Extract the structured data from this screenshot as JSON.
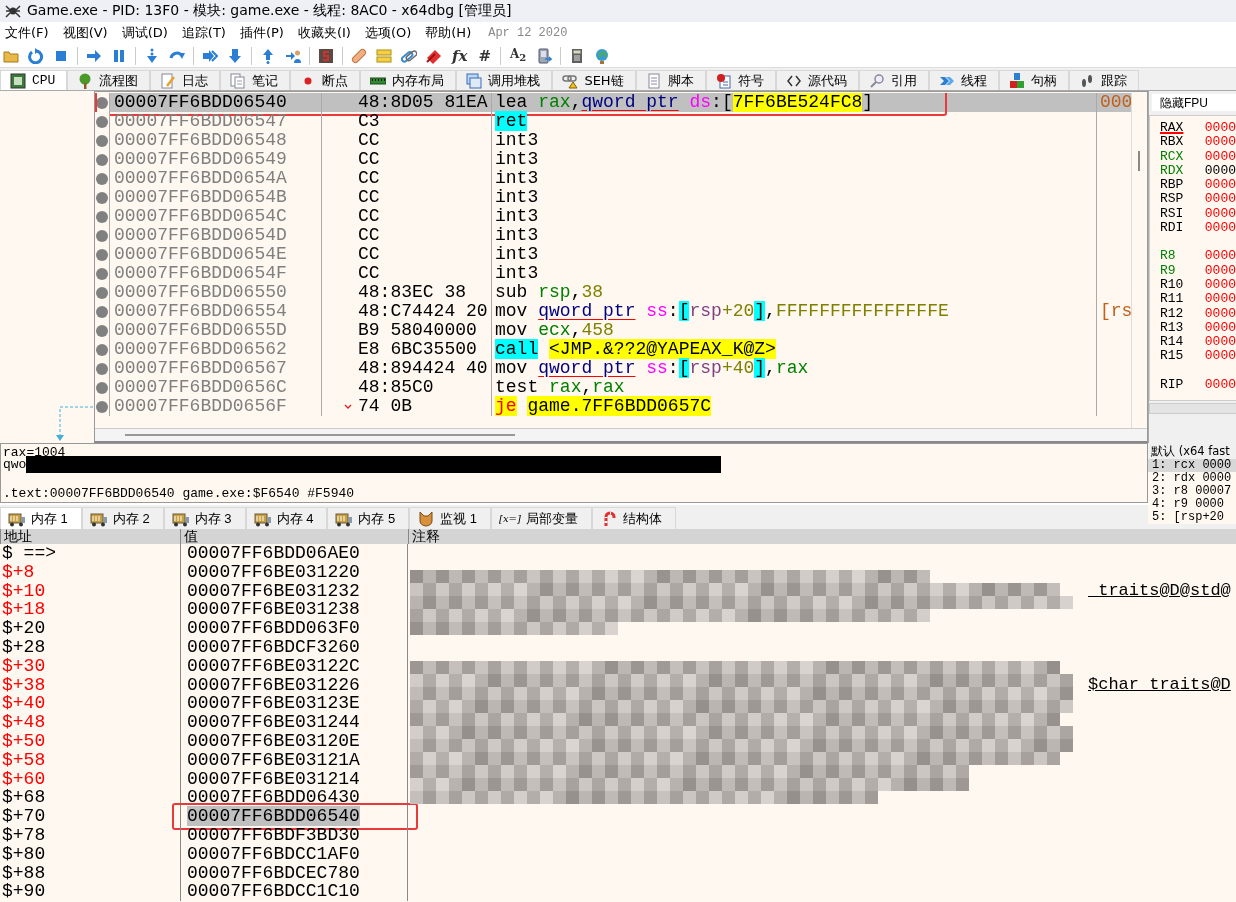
{
  "window": {
    "title": "Game.exe - PID: 13F0 - 模块: game.exe - 线程: 8AC0 - x64dbg [管理员]"
  },
  "menu": [
    "文件(F)",
    "视图(V)",
    "调试(D)",
    "追踪(T)",
    "插件(P)",
    "收藏夹(I)",
    "选项(O)",
    "帮助(H)"
  ],
  "build_date": "Apr 12 2020",
  "toolbar": {
    "glyphs": [
      "fx",
      "#",
      "A$_{2}$"
    ]
  },
  "tabs": [
    {
      "label": "CPU",
      "selected": true
    },
    {
      "label": "流程图",
      "selected": false
    },
    {
      "label": "日志",
      "selected": false
    },
    {
      "label": "笔记",
      "selected": false
    },
    {
      "label": "断点",
      "selected": false
    },
    {
      "label": "内存布局",
      "selected": false
    },
    {
      "label": "调用堆栈",
      "selected": false
    },
    {
      "label": "SEH链",
      "selected": false
    },
    {
      "label": "脚本",
      "selected": false
    },
    {
      "label": "符号",
      "selected": false
    },
    {
      "label": "源代码",
      "selected": false
    },
    {
      "label": "引用",
      "selected": false
    },
    {
      "label": "线程",
      "selected": false
    },
    {
      "label": "句柄",
      "selected": false
    },
    {
      "label": "跟踪",
      "selected": false
    }
  ],
  "disassembly": {
    "rows": [
      {
        "address": "00007FF6BDD06540",
        "bytes": "48:8D05 81EA",
        "tokens": [
          {
            "text": "lea",
            "kind": "m"
          },
          {
            "text": "rax",
            "kind": "r"
          },
          {
            "text": ",",
            "kind": "p"
          },
          {
            "text": "qword ptr",
            "kind": "s"
          },
          {
            "text": "ds",
            "kind": "g"
          },
          {
            "text": ":[",
            "kind": "p"
          },
          {
            "text": "7FF6BE524FC8",
            "kind": "a"
          },
          {
            "text": "]",
            "kind": "p"
          }
        ],
        "comment": "000",
        "selected": true,
        "boxed": true,
        "jump": false
      },
      {
        "address": "00007FF6BDD06547",
        "bytes": "C3",
        "tokens": [
          {
            "text": "ret",
            "kind": "mc"
          }
        ],
        "selected": false,
        "boxed": false,
        "jump": false
      },
      {
        "address": "00007FF6BDD06548",
        "bytes": "CC",
        "tokens": [
          {
            "text": "int3",
            "kind": "m"
          }
        ],
        "selected": false,
        "boxed": false,
        "jump": false
      },
      {
        "address": "00007FF6BDD06549",
        "bytes": "CC",
        "tokens": [
          {
            "text": "int3",
            "kind": "m"
          }
        ],
        "selected": false,
        "boxed": false,
        "jump": false
      },
      {
        "address": "00007FF6BDD0654A",
        "bytes": "CC",
        "tokens": [
          {
            "text": "int3",
            "kind": "m"
          }
        ],
        "selected": false,
        "boxed": false,
        "jump": false
      },
      {
        "address": "00007FF6BDD0654B",
        "bytes": "CC",
        "tokens": [
          {
            "text": "int3",
            "kind": "m"
          }
        ],
        "selected": false,
        "boxed": false,
        "jump": false
      },
      {
        "address": "00007FF6BDD0654C",
        "bytes": "CC",
        "tokens": [
          {
            "text": "int3",
            "kind": "m"
          }
        ],
        "selected": false,
        "boxed": false,
        "jump": false
      },
      {
        "address": "00007FF6BDD0654D",
        "bytes": "CC",
        "tokens": [
          {
            "text": "int3",
            "kind": "m"
          }
        ],
        "selected": false,
        "boxed": false,
        "jump": false
      },
      {
        "address": "00007FF6BDD0654E",
        "bytes": "CC",
        "tokens": [
          {
            "text": "int3",
            "kind": "m"
          }
        ],
        "selected": false,
        "boxed": false,
        "jump": false
      },
      {
        "address": "00007FF6BDD0654F",
        "bytes": "CC",
        "tokens": [
          {
            "text": "int3",
            "kind": "m"
          }
        ],
        "selected": false,
        "boxed": false,
        "jump": false
      },
      {
        "address": "00007FF6BDD06550",
        "bytes": "48:83EC 38",
        "tokens": [
          {
            "text": "sub",
            "kind": "m"
          },
          {
            "text": "rsp",
            "kind": "r"
          },
          {
            "text": ",",
            "kind": "p"
          },
          {
            "text": "38",
            "kind": "n"
          }
        ],
        "selected": false,
        "boxed": false,
        "jump": false
      },
      {
        "address": "00007FF6BDD06554",
        "bytes": "48:C74424 20",
        "tokens": [
          {
            "text": "mov",
            "kind": "m"
          },
          {
            "text": "qword ptr",
            "kind": "s"
          },
          {
            "text": "ss",
            "kind": "g"
          },
          {
            "text": ":",
            "kind": "p"
          },
          {
            "text": "[",
            "kind": "b"
          },
          {
            "text": "rsp",
            "kind": "mr"
          },
          {
            "text": "+20",
            "kind": "n"
          },
          {
            "text": "]",
            "kind": "b"
          },
          {
            "text": ",",
            "kind": "p"
          },
          {
            "text": "FFFFFFFFFFFFFFFE",
            "kind": "n"
          }
        ],
        "comment": "[rs",
        "selected": false,
        "boxed": false,
        "jump": false
      },
      {
        "address": "00007FF6BDD0655D",
        "bytes": "B9 58040000",
        "tokens": [
          {
            "text": "mov",
            "kind": "m"
          },
          {
            "text": "ecx",
            "kind": "r"
          },
          {
            "text": ",",
            "kind": "p"
          },
          {
            "text": "458",
            "kind": "n"
          }
        ],
        "selected": false,
        "boxed": false,
        "jump": false
      },
      {
        "address": "00007FF6BDD06562",
        "bytes": "E8 6BC35500",
        "tokens": [
          {
            "text": "call",
            "kind": "mc"
          },
          {
            "text": "<JMP.&??2@YAPEAX_K@Z>",
            "kind": "a"
          }
        ],
        "selected": false,
        "boxed": false,
        "jump": false
      },
      {
        "address": "00007FF6BDD06567",
        "bytes": "48:894424 40",
        "tokens": [
          {
            "text": "mov",
            "kind": "m"
          },
          {
            "text": "qword ptr",
            "kind": "s"
          },
          {
            "text": "ss",
            "kind": "g"
          },
          {
            "text": ":",
            "kind": "p"
          },
          {
            "text": "[",
            "kind": "b"
          },
          {
            "text": "rsp",
            "kind": "mr"
          },
          {
            "text": "+40",
            "kind": "n"
          },
          {
            "text": "]",
            "kind": "b"
          },
          {
            "text": ",",
            "kind": "p"
          },
          {
            "text": "rax",
            "kind": "r"
          }
        ],
        "selected": false,
        "boxed": false,
        "jump": false
      },
      {
        "address": "00007FF6BDD0656C",
        "bytes": "48:85C0",
        "tokens": [
          {
            "text": "test",
            "kind": "m"
          },
          {
            "text": "rax",
            "kind": "r"
          },
          {
            "text": ",",
            "kind": "p"
          },
          {
            "text": "rax",
            "kind": "r"
          }
        ],
        "selected": false,
        "boxed": false,
        "jump": false
      },
      {
        "address": "00007FF6BDD0656F",
        "bytes": "74 0B",
        "tokens": [
          {
            "text": "je",
            "kind": "mj"
          },
          {
            "text": "game.7FF6BDD0657C",
            "kind": "a"
          }
        ],
        "selected": false,
        "boxed": false,
        "jump": true
      }
    ]
  },
  "registers": {
    "header": "隐藏FPU",
    "groups": [
      [
        {
          "name": "RAX",
          "value": "0000",
          "changed": true,
          "argument": false,
          "underlined": true
        },
        {
          "name": "RBX",
          "value": "0000",
          "changed": true,
          "argument": false,
          "underlined": false
        },
        {
          "name": "RCX",
          "value": "0000",
          "changed": true,
          "argument": true,
          "underlined": false
        },
        {
          "name": "RDX",
          "value": "0000",
          "changed": false,
          "argument": true,
          "underlined": false
        },
        {
          "name": "RBP",
          "value": "0000",
          "changed": true,
          "argument": false,
          "underlined": false
        },
        {
          "name": "RSP",
          "value": "0000",
          "changed": true,
          "argument": false,
          "underlined": false
        },
        {
          "name": "RSI",
          "value": "0000",
          "changed": true,
          "argument": false,
          "underlined": false
        },
        {
          "name": "RDI",
          "value": "0000",
          "changed": true,
          "argument": false,
          "underlined": false
        }
      ],
      [
        {
          "name": "R8",
          "value": "0000",
          "changed": true,
          "argument": true,
          "underlined": false
        },
        {
          "name": "R9",
          "value": "0000",
          "changed": true,
          "argument": true,
          "underlined": false
        },
        {
          "name": "R10",
          "value": "0000",
          "changed": true,
          "argument": false,
          "underlined": false
        },
        {
          "name": "R11",
          "value": "0000",
          "changed": true,
          "argument": false,
          "underlined": false
        },
        {
          "name": "R12",
          "value": "0000",
          "changed": true,
          "argument": false,
          "underlined": false
        },
        {
          "name": "R13",
          "value": "0000",
          "changed": true,
          "argument": false,
          "underlined": false
        },
        {
          "name": "R14",
          "value": "0000",
          "changed": true,
          "argument": false,
          "underlined": false
        },
        {
          "name": "R15",
          "value": "0000",
          "changed": true,
          "argument": false,
          "underlined": false
        }
      ],
      [
        {
          "name": "RIP",
          "value": "0000",
          "changed": true,
          "argument": false,
          "underlined": false
        }
      ]
    ]
  },
  "call_convention": {
    "header": "默认 (x64 fast",
    "rows": [
      {
        "text": "1: rcx 0000",
        "selected": true
      },
      {
        "text": "2: rdx 0000",
        "selected": false
      },
      {
        "text": "3: r8 00007",
        "selected": false
      },
      {
        "text": "4: r9 0000",
        "selected": false
      },
      {
        "text": "5: [rsp+20",
        "selected": false
      }
    ]
  },
  "info": {
    "lines": [
      {
        "text": "rax=1004",
        "redacted": false
      },
      {
        "text": "qwo",
        "redacted": true
      }
    ],
    "location": ".text:00007FF6BDD06540 game.exe:$F6540 #F5940"
  },
  "memory_tabs": [
    {
      "label": "内存 1",
      "selected": true
    },
    {
      "label": "内存 2",
      "selected": false
    },
    {
      "label": "内存 3",
      "selected": false
    },
    {
      "label": "内存 4",
      "selected": false
    },
    {
      "label": "内存 5",
      "selected": false
    },
    {
      "label": "监视 1",
      "selected": false
    },
    {
      "label": "局部变量",
      "icon_text": "[x=]",
      "selected": false
    },
    {
      "label": "结构体",
      "selected": false
    }
  ],
  "dump": {
    "columns": [
      "地址",
      "值",
      "注释"
    ],
    "comments_redacted": true,
    "rows": [
      {
        "address": "$ ==>",
        "changed": false,
        "value": "00007FF6BDD06AE0",
        "selected": false,
        "boxed": false
      },
      {
        "address": "$+8",
        "changed": true,
        "value": "00007FF6BE031220",
        "selected": false,
        "boxed": false
      },
      {
        "address": "$+10",
        "changed": true,
        "value": "00007FF6BE031232",
        "comment": "_traits@D@std@",
        "selected": false,
        "boxed": false
      },
      {
        "address": "$+18",
        "changed": true,
        "value": "00007FF6BE031238",
        "selected": false,
        "boxed": false
      },
      {
        "address": "$+20",
        "changed": false,
        "value": "00007FF6BDD063F0",
        "selected": false,
        "boxed": false
      },
      {
        "address": "$+28",
        "changed": false,
        "value": "00007FF6BDCF3260",
        "selected": false,
        "boxed": false
      },
      {
        "address": "$+30",
        "changed": true,
        "value": "00007FF6BE03122C",
        "selected": false,
        "boxed": false
      },
      {
        "address": "$+38",
        "changed": true,
        "value": "00007FF6BE031226",
        "comment": "$char_traits@D",
        "selected": false,
        "boxed": false
      },
      {
        "address": "$+40",
        "changed": true,
        "value": "00007FF6BE03123E",
        "selected": false,
        "boxed": false
      },
      {
        "address": "$+48",
        "changed": true,
        "value": "00007FF6BE031244",
        "selected": false,
        "boxed": false
      },
      {
        "address": "$+50",
        "changed": true,
        "value": "00007FF6BE03120E",
        "selected": false,
        "boxed": false
      },
      {
        "address": "$+58",
        "changed": true,
        "value": "00007FF6BE03121A",
        "selected": false,
        "boxed": false
      },
      {
        "address": "$+60",
        "changed": true,
        "value": "00007FF6BE031214",
        "selected": false,
        "boxed": false
      },
      {
        "address": "$+68",
        "changed": false,
        "value": "00007FF6BDD06430",
        "selected": false,
        "boxed": false
      },
      {
        "address": "$+70",
        "changed": false,
        "value": "00007FF6BDD06540",
        "selected": true,
        "boxed": true
      },
      {
        "address": "$+78",
        "changed": false,
        "value": "00007FF6BDF3BD30",
        "selected": false,
        "boxed": false
      },
      {
        "address": "$+80",
        "changed": false,
        "value": "00007FF6BDCC1AF0",
        "selected": false,
        "boxed": false
      },
      {
        "address": "$+88",
        "changed": false,
        "value": "00007FF6BDCEC780",
        "selected": false,
        "boxed": false
      },
      {
        "address": "$+90",
        "changed": false,
        "value": "00007FF6BDCC1C10",
        "selected": false,
        "boxed": false
      }
    ]
  }
}
